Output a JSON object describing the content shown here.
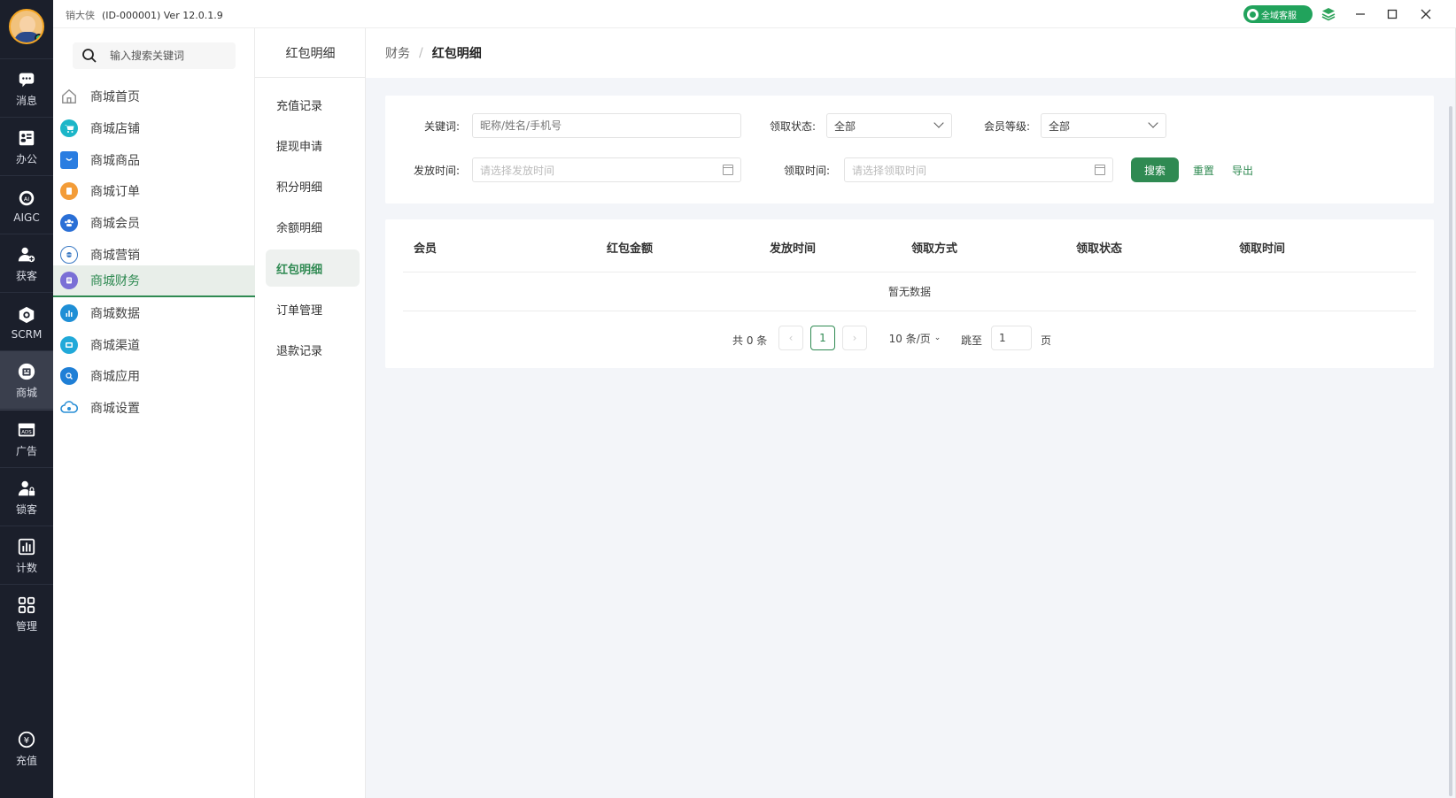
{
  "titlebar": {
    "app_name": "销大侠",
    "id_version": "(ID-000001)  Ver 12.0.1.9",
    "service_label": "全域客服"
  },
  "rail": {
    "items": [
      {
        "label": "消息",
        "icon": "message-icon"
      },
      {
        "label": "办公",
        "icon": "office-icon"
      },
      {
        "label": "AIGC",
        "icon": "ai-icon"
      },
      {
        "label": "获客",
        "icon": "acquire-icon"
      },
      {
        "label": "SCRM",
        "icon": "scrm-icon"
      },
      {
        "label": "商城",
        "icon": "shop-icon"
      },
      {
        "label": "广告",
        "icon": "ads-icon"
      },
      {
        "label": "锁客",
        "icon": "lock-customer-icon"
      },
      {
        "label": "计数",
        "icon": "stats-icon"
      },
      {
        "label": "管理",
        "icon": "grid-icon"
      }
    ],
    "recharge_label": "充值"
  },
  "modside": {
    "search_placeholder": "输入搜索关键词",
    "items": [
      {
        "label": "商城首页",
        "icon": "home-icon",
        "color": "#888888"
      },
      {
        "label": "商城店铺",
        "icon": "cart-icon",
        "color": "#1cb6c8"
      },
      {
        "label": "商城商品",
        "icon": "bag-icon",
        "color": "#2a7de1"
      },
      {
        "label": "商城订单",
        "icon": "order-icon",
        "color": "#f39c38"
      },
      {
        "label": "商城会员",
        "icon": "members-icon",
        "color": "#2a6fd6"
      },
      {
        "label": "商城营销",
        "icon": "marketing-icon",
        "color": "#3a79c4"
      },
      {
        "label": "商城财务",
        "icon": "finance-icon",
        "color": "#7a6fd6"
      },
      {
        "label": "商城数据",
        "icon": "data-icon",
        "color": "#1f8fd6"
      },
      {
        "label": "商城渠道",
        "icon": "channel-icon",
        "color": "#21a9d9"
      },
      {
        "label": "商城应用",
        "icon": "app-icon",
        "color": "#1f7fd6"
      },
      {
        "label": "商城设置",
        "icon": "settings-cloud-icon",
        "color": "#2a8fd6"
      }
    ]
  },
  "subnav": {
    "title": "红包明细",
    "items": [
      "充值记录",
      "提现申请",
      "积分明细",
      "余额明细",
      "红包明细",
      "订单管理",
      "退款记录"
    ]
  },
  "breadcrumb": {
    "parent": "财务",
    "current": "红包明细"
  },
  "filter": {
    "keyword_label": "关键词:",
    "keyword_placeholder": "昵称/姓名/手机号",
    "claim_status_label": "领取状态:",
    "claim_status_value": "全部",
    "member_level_label": "会员等级:",
    "member_level_value": "全部",
    "issue_time_label": "发放时间:",
    "issue_time_placeholder": "请选择发放时间",
    "claim_time_label": "领取时间:",
    "claim_time_placeholder": "请选择领取时间",
    "search_button": "搜索",
    "reset_link": "重置",
    "export_link": "导出"
  },
  "table": {
    "columns": [
      "会员",
      "红包金额",
      "发放时间",
      "领取方式",
      "领取状态",
      "领取时间"
    ],
    "empty_text": "暂无数据"
  },
  "pager": {
    "total_text": "共 0 条",
    "current_page": "1",
    "page_size": "10 条/页",
    "jump_label": "跳至",
    "jump_value": "1",
    "page_suffix": "页"
  }
}
